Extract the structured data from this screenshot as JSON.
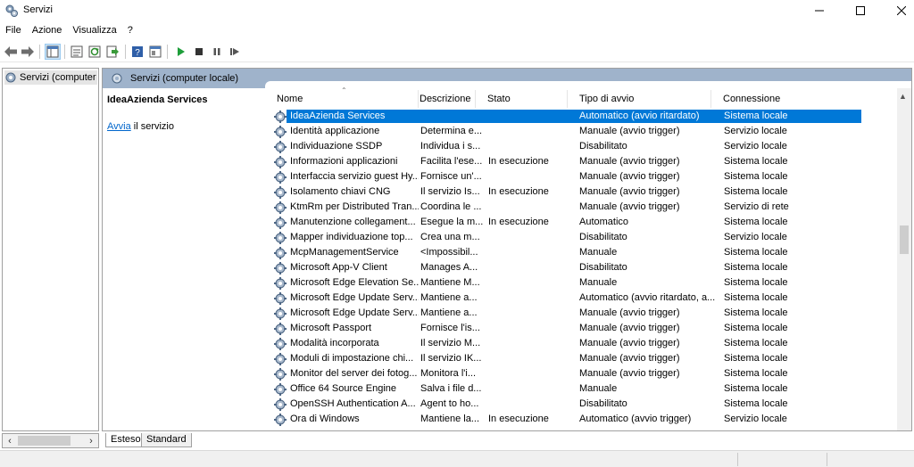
{
  "window": {
    "title": "Servizi",
    "colors": {
      "selection": "#0078d7",
      "pane_header": "#9fb3cb",
      "link": "#0066cc"
    }
  },
  "menubar": [
    "File",
    "Azione",
    "Visualizza",
    "?"
  ],
  "toolbar": {
    "icons": [
      "back-arrow-icon",
      "forward-arrow-icon",
      "show-tree-icon",
      "properties-icon",
      "refresh-icon",
      "export-list-icon",
      "help-icon",
      "console-view-icon",
      "start-service-icon",
      "stop-service-icon",
      "pause-service-icon",
      "restart-service-icon"
    ]
  },
  "tree": {
    "item_label": "Servizi (computer"
  },
  "pane_header": {
    "title": "Servizi (computer locale)"
  },
  "detail": {
    "service_name": "IdeaAzienda Services",
    "action_link": "Avvia",
    "action_rest": " il servizio"
  },
  "columns": {
    "name": "Nome",
    "desc": "Descrizione",
    "stato": "Stato",
    "tipo": "Tipo di avvio",
    "conn": "Connessione"
  },
  "services": [
    {
      "name": "IdeaAzienda Services",
      "desc": "",
      "stato": "",
      "tipo": "Automatico (avvio ritardato)",
      "conn": "Sistema locale",
      "selected": true
    },
    {
      "name": "Identità applicazione",
      "desc": "Determina e...",
      "stato": "",
      "tipo": "Manuale (avvio trigger)",
      "conn": "Servizio locale"
    },
    {
      "name": "Individuazione SSDP",
      "desc": "Individua i s...",
      "stato": "",
      "tipo": "Disabilitato",
      "conn": "Servizio locale"
    },
    {
      "name": "Informazioni applicazioni",
      "desc": "Facilita l'ese...",
      "stato": "In esecuzione",
      "tipo": "Manuale (avvio trigger)",
      "conn": "Sistema locale"
    },
    {
      "name": "Interfaccia servizio guest Hy...",
      "desc": "Fornisce un'...",
      "stato": "",
      "tipo": "Manuale (avvio trigger)",
      "conn": "Sistema locale"
    },
    {
      "name": "Isolamento chiavi CNG",
      "desc": "Il servizio Is...",
      "stato": "In esecuzione",
      "tipo": "Manuale (avvio trigger)",
      "conn": "Sistema locale"
    },
    {
      "name": "KtmRm per Distributed Tran...",
      "desc": "Coordina le ...",
      "stato": "",
      "tipo": "Manuale (avvio trigger)",
      "conn": "Servizio di rete"
    },
    {
      "name": "Manutenzione collegament...",
      "desc": "Esegue la m...",
      "stato": "In esecuzione",
      "tipo": "Automatico",
      "conn": "Sistema locale"
    },
    {
      "name": "Mapper individuazione top...",
      "desc": "Crea una m...",
      "stato": "",
      "tipo": "Disabilitato",
      "conn": "Servizio locale"
    },
    {
      "name": "McpManagementService",
      "desc": "<Impossibil...",
      "stato": "",
      "tipo": "Manuale",
      "conn": "Sistema locale"
    },
    {
      "name": "Microsoft App-V Client",
      "desc": "Manages A...",
      "stato": "",
      "tipo": "Disabilitato",
      "conn": "Sistema locale"
    },
    {
      "name": "Microsoft Edge Elevation Se...",
      "desc": "Mantiene M...",
      "stato": "",
      "tipo": "Manuale",
      "conn": "Sistema locale"
    },
    {
      "name": "Microsoft Edge Update Serv...",
      "desc": "Mantiene a...",
      "stato": "",
      "tipo": "Automatico (avvio ritardato, a...",
      "conn": "Sistema locale"
    },
    {
      "name": "Microsoft Edge Update Serv...",
      "desc": "Mantiene a...",
      "stato": "",
      "tipo": "Manuale (avvio trigger)",
      "conn": "Sistema locale"
    },
    {
      "name": "Microsoft Passport",
      "desc": "Fornisce l'is...",
      "stato": "",
      "tipo": "Manuale (avvio trigger)",
      "conn": "Sistema locale"
    },
    {
      "name": "Modalità incorporata",
      "desc": "Il servizio M...",
      "stato": "",
      "tipo": "Manuale (avvio trigger)",
      "conn": "Sistema locale"
    },
    {
      "name": "Moduli di impostazione chi...",
      "desc": "Il servizio IK...",
      "stato": "",
      "tipo": "Manuale (avvio trigger)",
      "conn": "Sistema locale"
    },
    {
      "name": "Monitor del server dei fotog...",
      "desc": "Monitora l'i...",
      "stato": "",
      "tipo": "Manuale (avvio trigger)",
      "conn": "Sistema locale"
    },
    {
      "name": "Office 64 Source Engine",
      "desc": "Salva i file d...",
      "stato": "",
      "tipo": "Manuale",
      "conn": "Sistema locale"
    },
    {
      "name": "OpenSSH Authentication A...",
      "desc": "Agent to ho...",
      "stato": "",
      "tipo": "Disabilitato",
      "conn": "Sistema locale"
    },
    {
      "name": "Ora di Windows",
      "desc": "Mantiene la...",
      "stato": "In esecuzione",
      "tipo": "Automatico (avvio trigger)",
      "conn": "Servizio locale"
    }
  ],
  "tabs": {
    "esteso": "Esteso",
    "standard": "Standard"
  }
}
